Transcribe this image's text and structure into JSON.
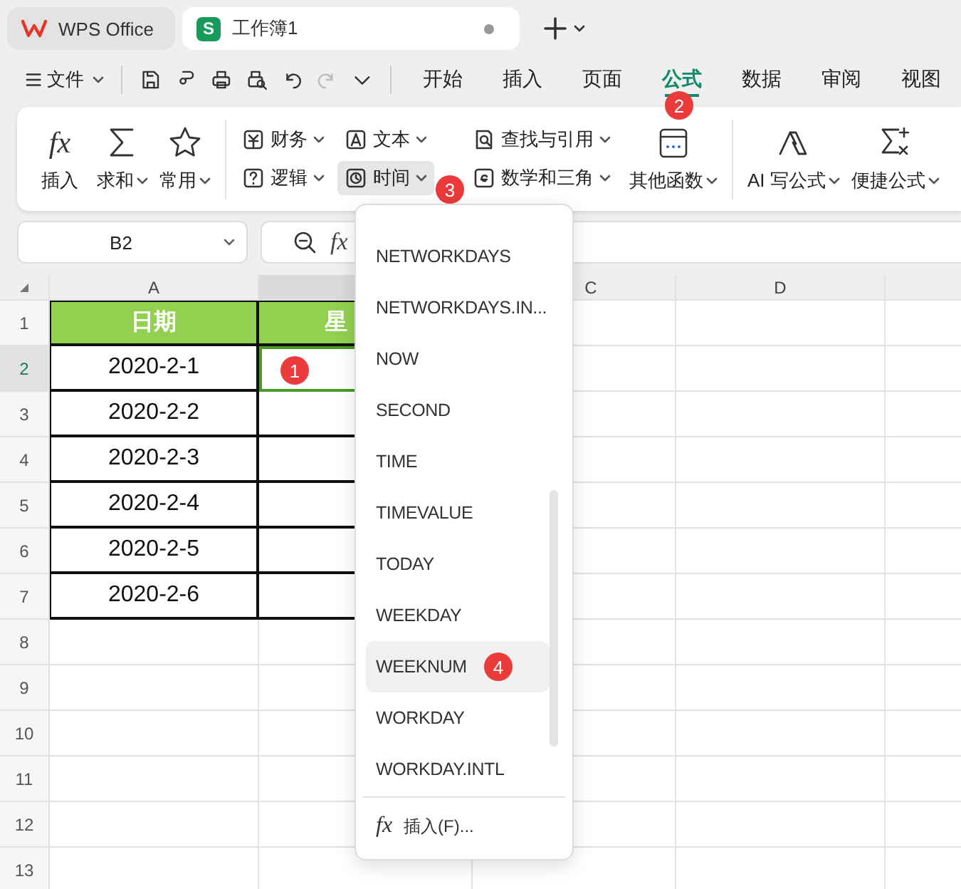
{
  "title_bar": {
    "tabs": [
      {
        "kind": "home",
        "label": "WPS Office",
        "selected": false
      },
      {
        "kind": "document",
        "label": "工作簿1",
        "icon_text": "S",
        "selected": true,
        "unsaved": true
      }
    ]
  },
  "menu_bar": {
    "file_menu": "文件",
    "quick_access": [
      {
        "kind": "save",
        "disabled": false
      },
      {
        "kind": "painter",
        "disabled": false
      },
      {
        "kind": "print",
        "disabled": false
      },
      {
        "kind": "preview",
        "disabled": false
      },
      {
        "kind": "undo",
        "disabled": false
      },
      {
        "kind": "redo",
        "disabled": true
      },
      {
        "kind": "more",
        "disabled": false
      }
    ],
    "tabs": [
      {
        "label": "开始",
        "selected": false
      },
      {
        "label": "插入",
        "selected": false
      },
      {
        "label": "页面",
        "selected": false
      },
      {
        "label": "公式",
        "selected": true,
        "badge": "2"
      },
      {
        "label": "数据",
        "selected": false
      },
      {
        "label": "审阅",
        "selected": false
      },
      {
        "label": "视图",
        "selected": false
      }
    ]
  },
  "ribbon": {
    "groups": [
      {
        "buttons": [
          {
            "kind": "large",
            "icon_text": "fx",
            "label": "插入",
            "dropdown": false
          },
          {
            "kind": "large",
            "label": "求和",
            "dropdown": true
          },
          {
            "kind": "large",
            "label": "常用",
            "dropdown": true
          }
        ]
      },
      {
        "buttons": [
          {
            "kind": "small",
            "label": "财务",
            "dropdown": true,
            "active": false
          },
          {
            "kind": "small",
            "label": "文本",
            "dropdown": true,
            "active": false
          },
          {
            "kind": "small",
            "label": "查找与引用",
            "dropdown": true,
            "active": false
          },
          {
            "kind": "small",
            "label": "逻辑",
            "dropdown": true,
            "active": false
          },
          {
            "kind": "small",
            "label": "时间",
            "dropdown": true,
            "active": true,
            "badge": "3"
          },
          {
            "kind": "small",
            "label": "数学和三角",
            "dropdown": true,
            "active": false
          },
          {
            "kind": "large",
            "label": "其他函数",
            "dropdown": true
          }
        ]
      },
      {
        "buttons": [
          {
            "kind": "large",
            "label": "AI 写公式",
            "dropdown": true
          },
          {
            "kind": "large",
            "label": "便捷公式",
            "dropdown": true
          }
        ]
      }
    ]
  },
  "formula_bar": {
    "name_box": "B2",
    "fx": "fx"
  },
  "sheet": {
    "columns": [
      {
        "label": "A",
        "selected": false
      },
      {
        "selected": true
      },
      {
        "label": "C",
        "selected": false
      },
      {
        "label": "D",
        "selected": false
      }
    ],
    "rows": [
      {
        "label": "1",
        "kind": "header",
        "selected": false,
        "cells": [
          {
            "text": "日期",
            "selected": false
          },
          {
            "text": "星",
            "selected": false
          }
        ]
      },
      {
        "label": "2",
        "kind": "data",
        "selected": true,
        "cells": [
          {
            "text": "2020-2-1",
            "selected": false
          },
          {
            "selected": true,
            "badge": "1"
          }
        ]
      },
      {
        "label": "3",
        "kind": "data",
        "selected": false,
        "cells": [
          {
            "text": "2020-2-2",
            "selected": false
          },
          {
            "selected": false
          }
        ]
      },
      {
        "label": "4",
        "kind": "data",
        "selected": false,
        "cells": [
          {
            "text": "2020-2-3",
            "selected": false
          },
          {
            "selected": false
          }
        ]
      },
      {
        "label": "5",
        "kind": "data",
        "selected": false,
        "cells": [
          {
            "text": "2020-2-4",
            "selected": false
          },
          {
            "selected": false
          }
        ]
      },
      {
        "label": "6",
        "kind": "data",
        "selected": false,
        "cells": [
          {
            "text": "2020-2-5",
            "selected": false
          },
          {
            "selected": false
          }
        ]
      },
      {
        "label": "7",
        "kind": "data",
        "selected": false,
        "cells": [
          {
            "text": "2020-2-6",
            "selected": false
          },
          {
            "selected": false
          }
        ]
      },
      {
        "label": "8",
        "selected": false
      },
      {
        "label": "9",
        "selected": false
      },
      {
        "label": "10",
        "selected": false
      },
      {
        "label": "11",
        "selected": false
      },
      {
        "label": "12",
        "selected": false
      },
      {
        "label": "13",
        "selected": false
      }
    ]
  },
  "function_menu": {
    "items": [
      {
        "label": "NETWORKDAYS",
        "selected": false
      },
      {
        "label": "NETWORKDAYS.IN...",
        "selected": false
      },
      {
        "label": "NOW",
        "selected": false
      },
      {
        "label": "SECOND",
        "selected": false
      },
      {
        "label": "TIME",
        "selected": false
      },
      {
        "label": "TIMEVALUE",
        "selected": false
      },
      {
        "label": "TODAY",
        "selected": false
      },
      {
        "label": "WEEKDAY",
        "selected": false
      },
      {
        "label": "WEEKNUM",
        "selected": true,
        "badge": "4"
      },
      {
        "label": "WORKDAY",
        "selected": false
      },
      {
        "label": "WORKDAY.INTL",
        "selected": false
      }
    ],
    "footer": {
      "icon_text": "fx",
      "label": "插入(F)..."
    }
  }
}
